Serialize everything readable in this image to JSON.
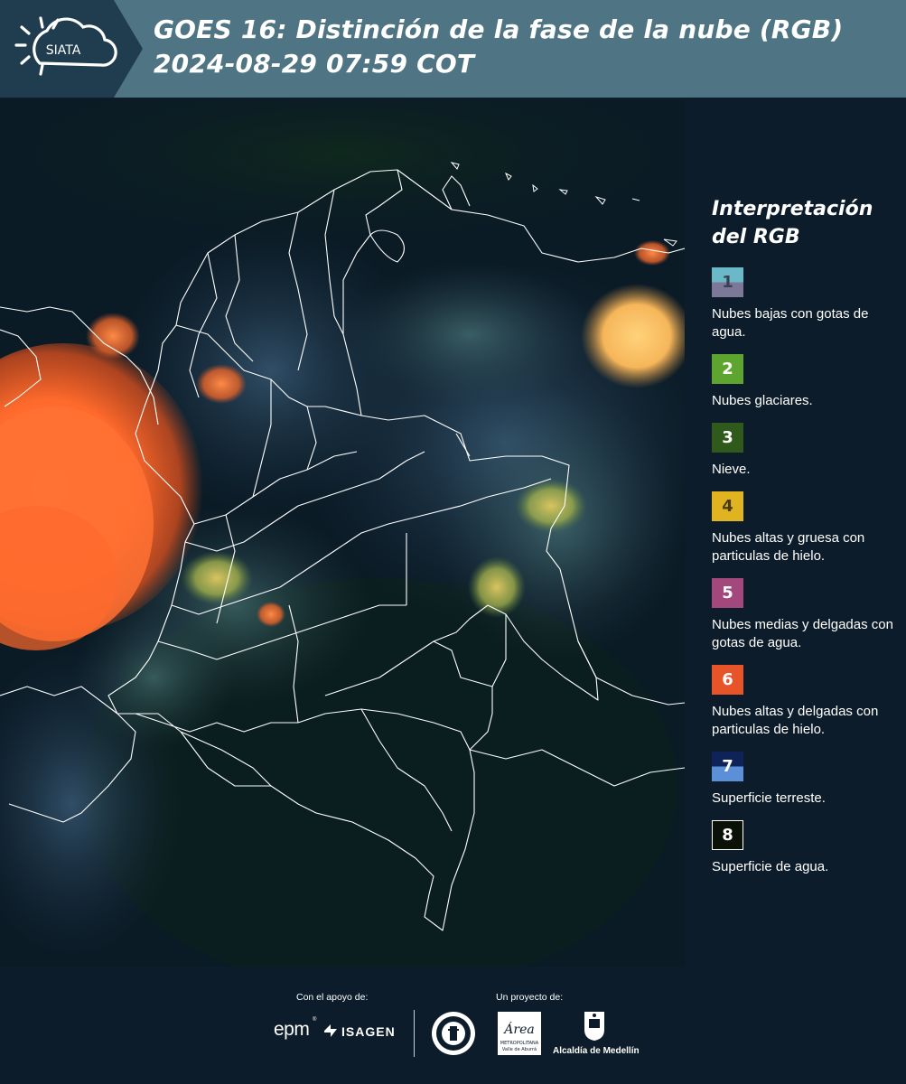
{
  "header": {
    "brand": "SIATA",
    "title_line1": "GOES 16: Distinción de la fase de la nube (RGB)",
    "title_line2": " 2024-08-29 07:59 COT",
    "logo_icon": "sun-cloud-icon"
  },
  "legend": {
    "title_line1": "Interpretación",
    "title_line2": "del RGB",
    "items": [
      {
        "num": "1",
        "top_color": "#6ab8c8",
        "bottom_color": "#7c7898",
        "num_color": "#3a3f55",
        "text": "Nubes bajas con gotas de agua."
      },
      {
        "num": "2",
        "top_color": "#5da52e",
        "bottom_color": "#5da52e",
        "num_color": "#ffffff",
        "text": "Nubes glaciares."
      },
      {
        "num": "3",
        "top_color": "#2f5a1c",
        "bottom_color": "#2f5a1c",
        "num_color": "#ffffff",
        "text": "Nieve."
      },
      {
        "num": "4",
        "top_color": "#e0b320",
        "bottom_color": "#e0b320",
        "num_color": "#4a3c10",
        "text": "Nubes altas y gruesa con particulas de hielo."
      },
      {
        "num": "5",
        "top_color": "#a3487c",
        "bottom_color": "#a3487c",
        "num_color": "#ffffff",
        "text": "Nubes medias y delgadas con gotas de agua."
      },
      {
        "num": "6",
        "top_color": "#e8542a",
        "bottom_color": "#e8542a",
        "num_color": "#ffffff",
        "text": "Nubes altas y delgadas con particulas de hielo."
      },
      {
        "num": "7",
        "top_color": "#0e2358",
        "bottom_color": "#5b8fd8",
        "num_color": "#ffffff",
        "text": "Superficie terreste."
      },
      {
        "num": "8",
        "top_color": "#0a1208",
        "bottom_color": "#0a1208",
        "num_color": "#ffffff",
        "text": "Superficie de agua."
      }
    ]
  },
  "footer": {
    "support_label": "Con el apoyo de:",
    "project_label": "Un proyecto de:",
    "epm": "epm",
    "isagen": "ISAGEN",
    "area_main": "Área",
    "area_sub1": "METROPOLITANA",
    "area_sub2": "Valle de Aburrá",
    "alcaldia": "Alcaldía de Medellín"
  },
  "colors": {
    "header_bg": "#4f7584",
    "page_bg": "#0d1c2a",
    "ocean": "#0a1a26",
    "border_lines": "#ffffff"
  }
}
